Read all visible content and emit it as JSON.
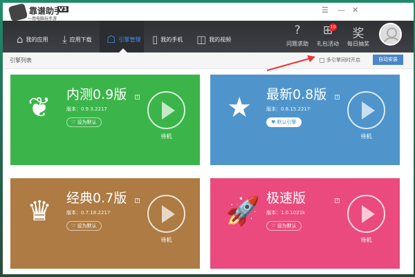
{
  "app": {
    "brand": "靠谱助手",
    "version_badge": "V3",
    "slogan": "一用电脑玩手游"
  },
  "window_controls": [
    "☰",
    "—",
    "✕"
  ],
  "nav": [
    {
      "label": "我的应用",
      "icon": "home-icon",
      "glyph": "⌂"
    },
    {
      "label": "应用下载",
      "icon": "download-icon",
      "glyph": "⤓"
    },
    {
      "label": "引擎管理",
      "icon": "android-icon",
      "glyph": "☖",
      "active": true
    },
    {
      "label": "我的手机",
      "icon": "phone-icon",
      "glyph": "▯"
    },
    {
      "label": "我的视频",
      "icon": "video-camera-icon",
      "glyph": "◫"
    }
  ],
  "tools": [
    {
      "label": "问题求助",
      "icon": "help-icon",
      "glyph": "?"
    },
    {
      "label": "礼包活动",
      "icon": "gift-icon",
      "glyph": "⊞",
      "badge": "10"
    },
    {
      "label": "每日抽奖",
      "icon": "lottery-icon",
      "glyph": "奖"
    }
  ],
  "toolbar": {
    "list_label": "引擎列表",
    "multi_label": "多引擎同时开启",
    "multi_checked": false,
    "auto_install": "自动安装"
  },
  "cards": [
    {
      "title": "内测0.9版",
      "version": "版本：0.9.3.2217",
      "default_label": "设为默认",
      "is_default": false,
      "status": "待机",
      "color": "#3bb54a",
      "icon": "leaf-icon",
      "glyph": "❦"
    },
    {
      "title": "最新0.8版",
      "version": "版本：0.8.15.2217",
      "default_label": "默认引擎",
      "is_default": true,
      "status": "待机",
      "color": "#4f95cc",
      "icon": "star-icon",
      "glyph": "★"
    },
    {
      "title": "经典0.7版",
      "version": "版本：0.7.18.2217",
      "default_label": "设为默认",
      "is_default": false,
      "status": "待机",
      "color": "#ad7b43",
      "icon": "crown-icon",
      "glyph": "♛"
    },
    {
      "title": "极速版",
      "version": "版本：1.0.1021k",
      "default_label": "设为默认",
      "is_default": false,
      "status": "待机",
      "color": "#ea4a7d",
      "icon": "rocket-icon",
      "glyph": "🚀"
    }
  ],
  "help_mark": "?"
}
